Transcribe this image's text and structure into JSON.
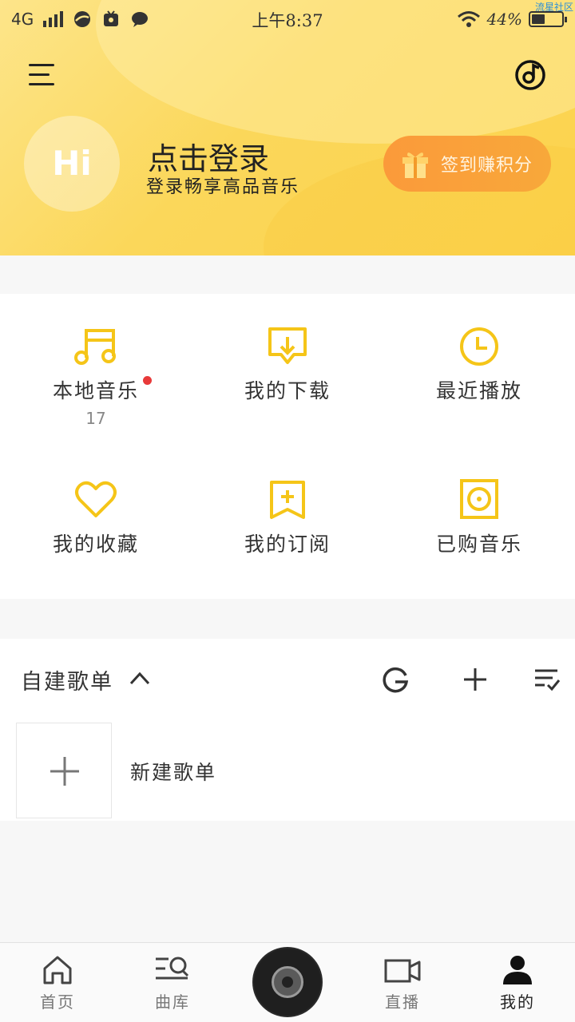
{
  "status_bar": {
    "network": "4G",
    "time": "上午8:37",
    "battery": "44%",
    "watermark": "流星社区",
    "icons": [
      "signal-icon",
      "browser-icon",
      "app-icon",
      "chat-icon",
      "wifi-icon",
      "battery-icon"
    ]
  },
  "header": {
    "avatar_text": "Hi",
    "login_title": "点击登录",
    "login_subtitle": "登录畅享高品音乐",
    "checkin_label": "签到赚积分",
    "colors": {
      "header_bg": "#fbd75a",
      "checkin_bg": "#fb9a3a"
    }
  },
  "shortcuts": [
    {
      "label": "本地音乐",
      "count": "17",
      "icon": "music-note-icon",
      "has_dot": true
    },
    {
      "label": "我的下载",
      "icon": "download-icon"
    },
    {
      "label": "最近播放",
      "icon": "clock-icon"
    },
    {
      "label": "我的收藏",
      "icon": "heart-icon"
    },
    {
      "label": "我的订阅",
      "icon": "bookmark-plus-icon"
    },
    {
      "label": "已购音乐",
      "icon": "purchased-disc-icon"
    }
  ],
  "playlists": {
    "title": "自建歌单",
    "new_label": "新建歌单"
  },
  "tabbar": {
    "tabs": [
      {
        "label": "首页",
        "icon": "home-icon"
      },
      {
        "label": "曲库",
        "icon": "library-search-icon"
      },
      {
        "label": "直播",
        "icon": "video-camera-icon"
      },
      {
        "label": "我的",
        "icon": "user-icon",
        "active": true
      }
    ]
  },
  "accent_color": "#f5c518"
}
